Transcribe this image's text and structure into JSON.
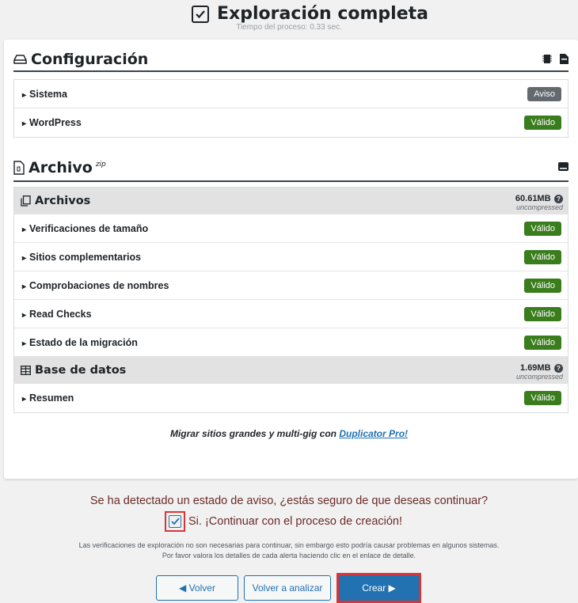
{
  "header": {
    "title": "Exploración completa",
    "subtitle": "Tiempo del proceso: 0.33 sec."
  },
  "config": {
    "title": "Configuración",
    "rows": [
      {
        "label": "Sistema",
        "status": "Aviso",
        "color": "#646970"
      },
      {
        "label": "WordPress",
        "status": "Válido",
        "color": "#3a7d1d"
      }
    ]
  },
  "archive": {
    "title": "Archivo",
    "format": "zip",
    "files": {
      "title": "Archivos",
      "size": "60.61MB",
      "size_note": "uncompressed",
      "rows": [
        {
          "label": "Verificaciones de tamaño",
          "status": "Válido"
        },
        {
          "label": "Sitios complementarios",
          "status": "Válido"
        },
        {
          "label": "Comprobaciones de nombres",
          "status": "Válido"
        },
        {
          "label": "Read Checks",
          "status": "Válido"
        },
        {
          "label": "Estado de la migración",
          "status": "Válido"
        }
      ]
    },
    "database": {
      "title": "Base de datos",
      "size": "1.69MB",
      "size_note": "uncompressed",
      "rows": [
        {
          "label": "Resumen",
          "status": "Válido"
        }
      ]
    }
  },
  "promo": {
    "text": "Migrar sitios grandes y multi-gig con ",
    "link": "Duplicator Pro!"
  },
  "warning": {
    "message": "Se ha detectado un estado de aviso, ¿estás seguro de que deseas continuar?",
    "confirm_label": "Si. ¡Continuar con el proceso de creación!",
    "confirm_checked": true,
    "note_line1": "Las verificaciones de exploración no son necesarias para continuar, sin embargo esto podría causar problemas en algunos sistemas.",
    "note_line2": "Por favor valora los detalles de cada alerta haciendo clic en el enlace de detalle."
  },
  "buttons": {
    "back": "◀ Volver",
    "rescan": "Volver a analizar",
    "create": "Crear ▶"
  },
  "colors": {
    "valid": "#3a7d1d",
    "warn": "#646970",
    "primary": "#2271b1",
    "highlight": "#d63638"
  }
}
